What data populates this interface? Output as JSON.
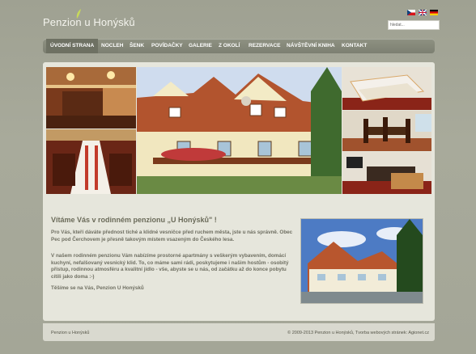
{
  "header": {
    "logo_text": "Penzion u Honýsků",
    "languages": [
      {
        "code": "cz",
        "icon": "czech-flag-icon"
      },
      {
        "code": "en",
        "icon": "uk-flag-icon"
      },
      {
        "code": "de",
        "icon": "german-flag-icon"
      }
    ],
    "search_value": "hledat..."
  },
  "nav": {
    "items": [
      "ÚVODNÍ STRANA",
      "NOCLEH",
      "ŠENK",
      "POVÍDAČKY",
      "GALERIE",
      "Z OKOLÍ",
      "REZERVACE",
      "NÁVŠTĚVNÍ KNIHA",
      "KONTAKT"
    ],
    "active": "ÚVODNÍ STRANA"
  },
  "main": {
    "heading": "Vítáme Vás v rodinném penzionu „U Honýsků\" !",
    "paragraphs": [
      "Pro Vás, kteří dáváte přednost  tiché a klidné vesničce před ruchem města, jste u nás správně. Obec Pec pod Čerchovem je přesně takovým místem vsazeným do Českého lesa.",
      "V našem rodinném penzionu Vám nabízíme prostorné apartmány s veškerým vybavením, domácí kuchyní, nefalšovaný vesnický klid. To, co máme sami rádi, poskytujeme i našim hostům - osobitý přístup, rodinnou atmosféru a kvalitní jídlo - vše, abyste se u nás, od začátku až do konce pobytu cítili jako doma :-)",
      "Těšíme se na Vás, Penzion U Honýsků"
    ]
  },
  "footer": {
    "left": "Penzion u Honýsků",
    "right": "© 2009-2013 Penzion u Honýsků, Tvorba webových stránek: Agionet.cz"
  },
  "colors": {
    "background": "#a3a595",
    "nav": "#848779",
    "content": "#e6e6dc",
    "heading": "#6b6b5a"
  }
}
